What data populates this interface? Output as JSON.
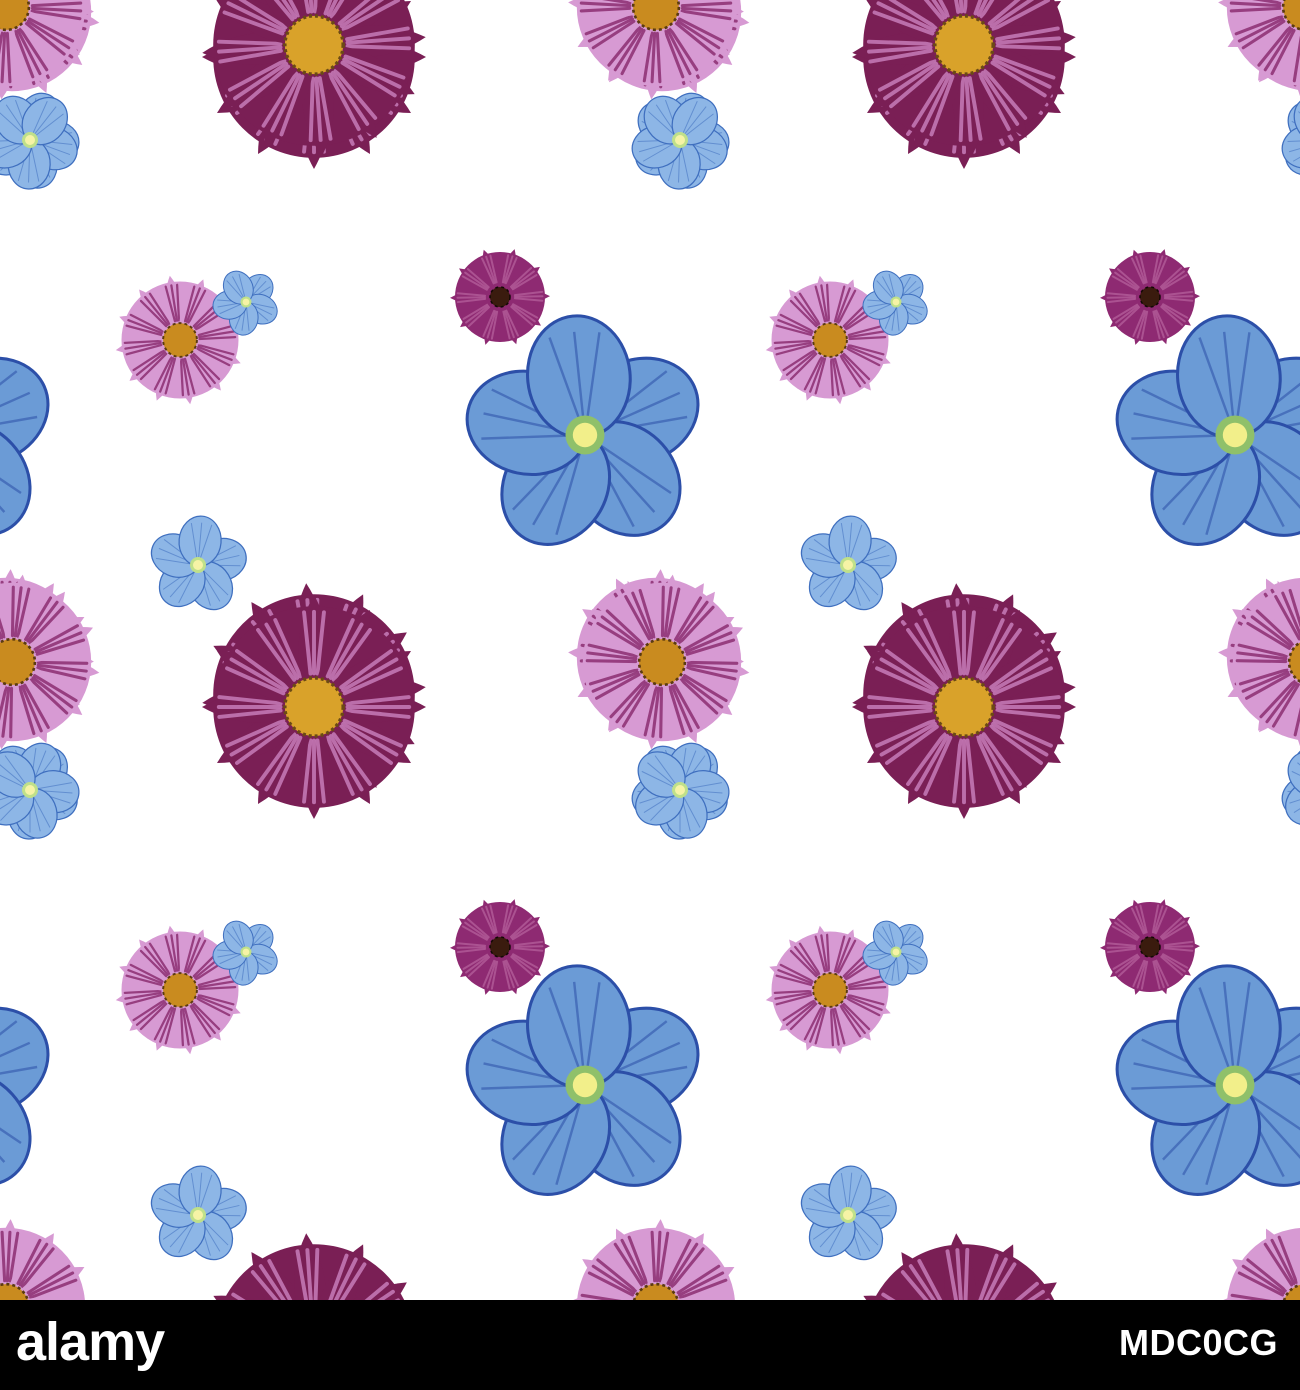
{
  "pattern": {
    "background": "#ffffff",
    "flower_types": {
      "deep_cosmos": {
        "petal": "#7a1f55",
        "stripe": "#c77cb9",
        "center": "#d9a22a",
        "center_dark": "#6b4a14"
      },
      "pink_cosmos": {
        "petal": "#d79ad3",
        "stripe": "#8c2f72",
        "center": "#c98b1f",
        "center_dark": "#5b3a10"
      },
      "small_purple": {
        "petal": "#8e2a72",
        "stripe": "#b15a97",
        "center": "#3a1b0e",
        "center_dark": "#120805"
      },
      "blue_flax": {
        "petal": "#6b9bd6",
        "stripe": "#2c4fa8",
        "center": "#f2ef8a",
        "center_dark": "#8fc06a"
      },
      "forget_me_not": {
        "petal": "#8db6e6",
        "stripe": "#3f6fbf",
        "center": "#f6f3a6",
        "center_dark": "#bfe08a"
      }
    }
  },
  "watermark": {
    "brand": "alamy",
    "stock_id": "MDC0CG",
    "footer_color": "#000000",
    "text_color": "#ffffff"
  }
}
